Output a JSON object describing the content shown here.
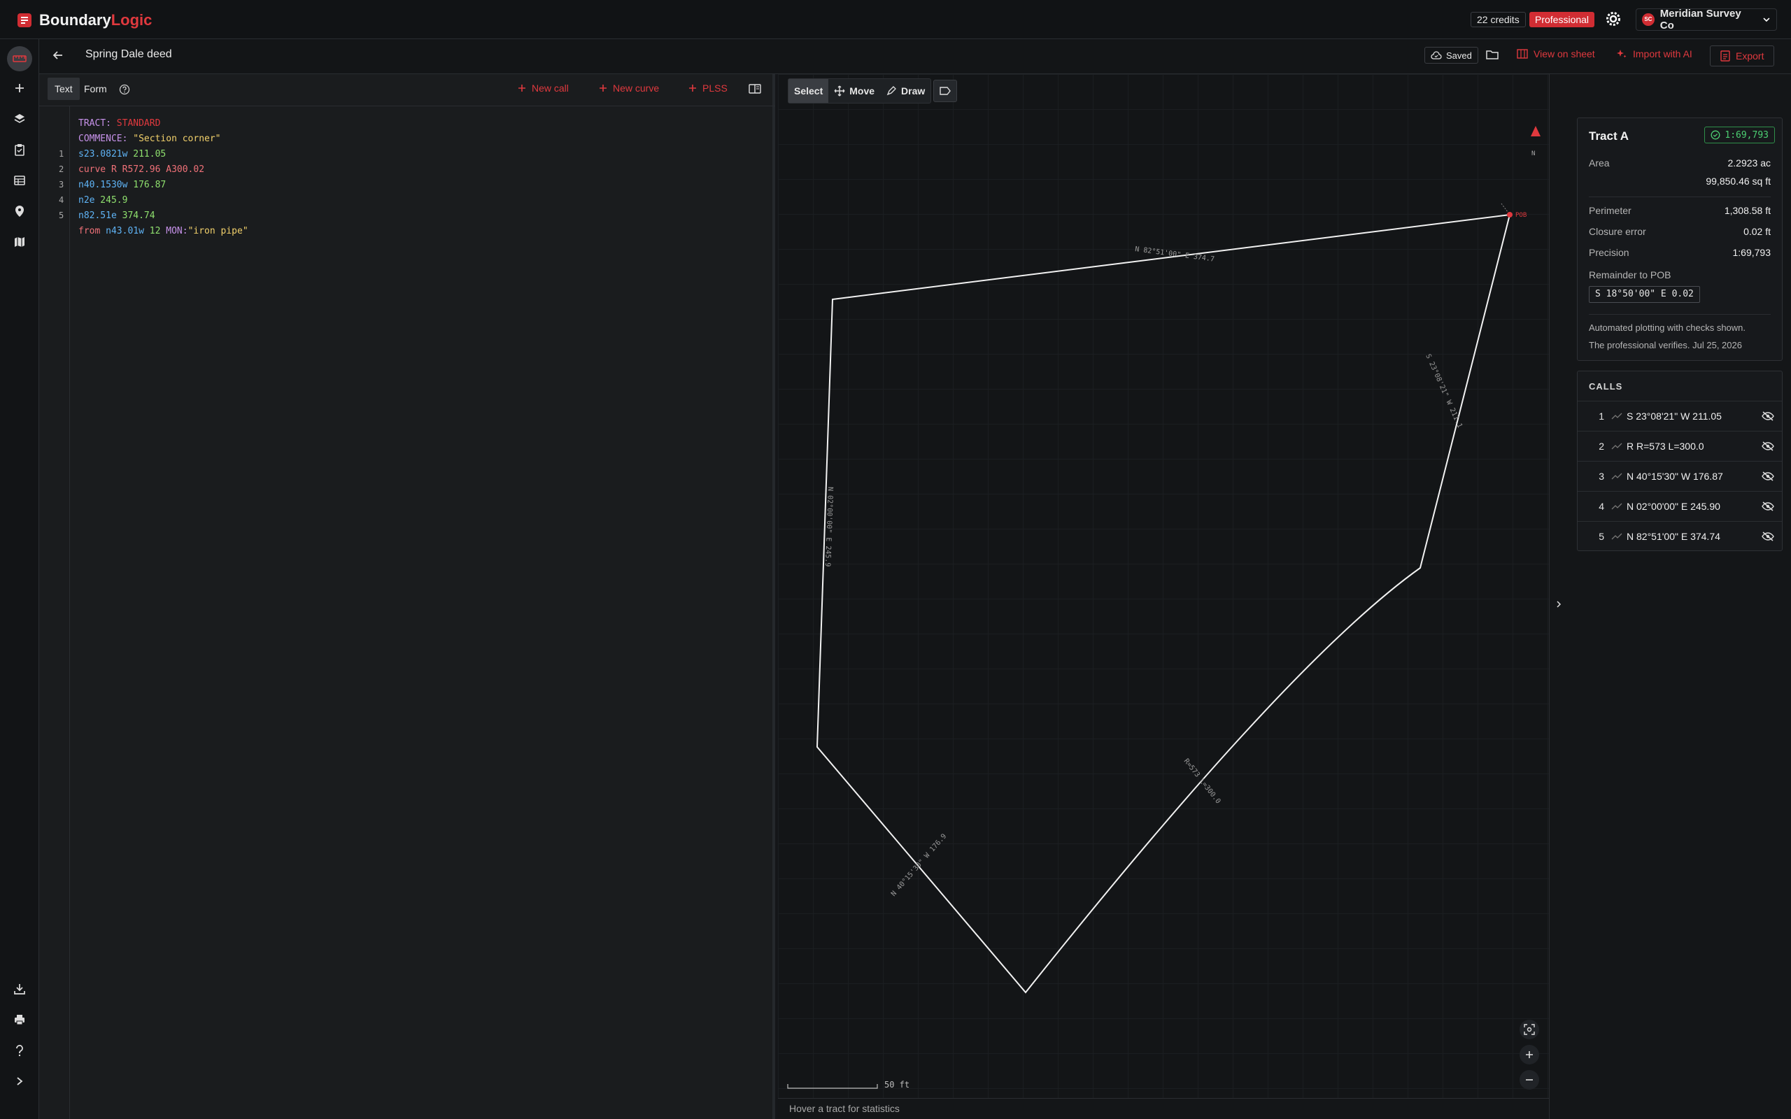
{
  "app": {
    "name_part1": "Boundary",
    "name_part2": "Logic"
  },
  "topbar": {
    "credits": "22 credits",
    "plan": "Professional",
    "account_initials": "SC",
    "account_name": "Meridian Survey Co"
  },
  "subbar": {
    "doc_title": "Spring Dale deed",
    "saved": "Saved",
    "view_on_sheet": "View on sheet",
    "import_ai": "Import with AI",
    "export": "Export"
  },
  "editor": {
    "tabs": [
      "Text",
      "Form"
    ],
    "actions": {
      "new_call": "New call",
      "new_curve": "New curve",
      "plss": "PLSS"
    },
    "line_numbers": [
      "1",
      "2",
      "3",
      "4",
      "5"
    ],
    "lines": [
      [
        "TRACT:",
        " STANDARD"
      ],
      [
        "COMMENCE:",
        " \"Section corner\""
      ],
      [
        "s23.0821w",
        " 211.05"
      ],
      [
        "curve R",
        " R572.96 A300.02"
      ],
      [
        "n40.1530w",
        " 176.87"
      ],
      [
        "n2e",
        " 245.9"
      ],
      [
        "n82.51e",
        " 374.74"
      ],
      [
        "from",
        " n43.01w",
        " 12",
        " MON:",
        "\"iron pipe\""
      ]
    ]
  },
  "map": {
    "tools": [
      "Select",
      "Move",
      "Draw"
    ],
    "north": "N",
    "pob": "POB",
    "labels": {
      "l5": "N 82°51'00\" E 374.7",
      "l1": "S 23°08'21\" W 211.1",
      "l4": "N 02°00'00\" E 245.9",
      "l3": "N 40°15'30\" W 176.9",
      "l2": "R=573 L=300.0"
    },
    "scale": "50 ft",
    "status": "Hover a tract for statistics"
  },
  "tract": {
    "name": "Tract A",
    "precision_badge": "1:69,793",
    "area_ac": "2.2923 ac",
    "area_sqft": "99,850.46 sq ft",
    "stats": [
      {
        "label": "Perimeter",
        "value": "1,308.58 ft"
      },
      {
        "label": "Closure error",
        "value": "0.02 ft"
      },
      {
        "label": "Precision",
        "value": "1:69,793"
      }
    ],
    "area_label": "Area",
    "remainder_label": "Remainder to POB",
    "remainder_value": "S 18°50'00\" E 0.02",
    "note1": "Automated plotting with checks shown.",
    "note2": "The professional verifies. Jul 25, 2026"
  },
  "calls": {
    "header": "CALLS",
    "items": [
      {
        "n": "1",
        "text": "S 23°08'21\" W 211.05"
      },
      {
        "n": "2",
        "text": "R R=573 L=300.0"
      },
      {
        "n": "3",
        "text": "N 40°15'30\" W 176.87"
      },
      {
        "n": "4",
        "text": "N 02°00'00\" E 245.90"
      },
      {
        "n": "5",
        "text": "N 82°51'00\" E 374.74"
      }
    ]
  },
  "colors": {
    "accent": "#e0393e",
    "success": "#4ccf72",
    "bg": "#141619"
  }
}
